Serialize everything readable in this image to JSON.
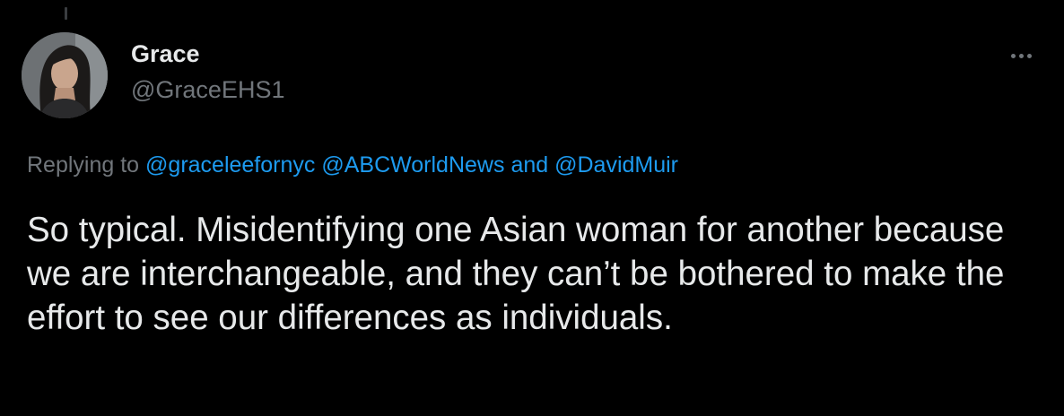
{
  "tweet": {
    "author": {
      "display_name": "Grace",
      "handle": "@GraceEHS1",
      "avatar_icon": "profile-photo"
    },
    "more_icon": "more-horizontal-icon",
    "reply_context": {
      "prefix": "Replying to",
      "mentions": [
        "@graceleefornyc",
        "@ABCWorldNews",
        "@DavidMuir"
      ],
      "conjunction": "and"
    },
    "text": "So typical. Misidentifying one Asian woman for another because we are interchangeable, and they can’t be bothered to make the effort to see our differences as individuals."
  },
  "theme": {
    "background": "#000000",
    "text_primary": "#e7e9ea",
    "text_secondary": "#71767b",
    "accent": "#1d9bf0"
  }
}
